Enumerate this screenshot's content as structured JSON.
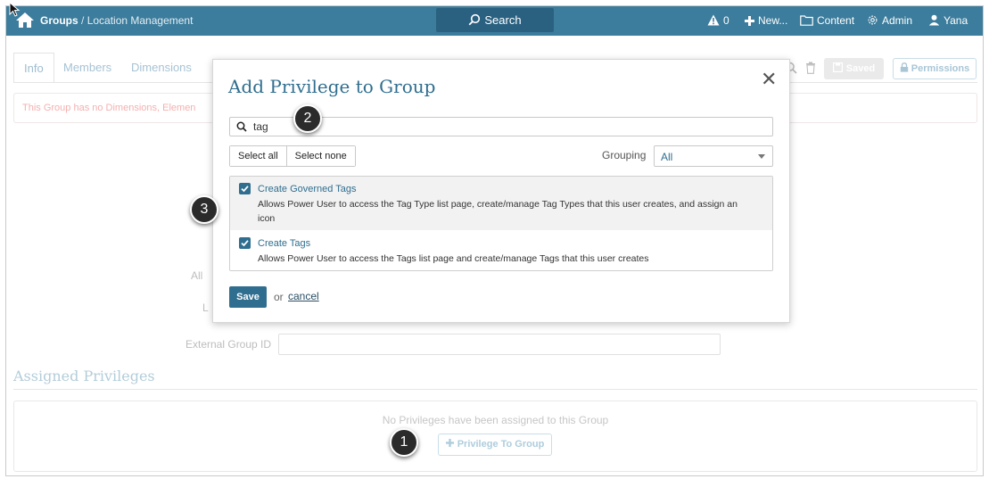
{
  "topnav": {
    "breadcrumb_root": "Groups",
    "breadcrumb_sep": " / ",
    "breadcrumb_current": "Location Management",
    "search_label": "Search",
    "alerts_count": "0",
    "new_label": "New...",
    "content_label": "Content",
    "admin_label": "Admin",
    "user_label": "Yana",
    "bar_color": "#3c7c9c"
  },
  "page": {
    "tabs": [
      "Info",
      "Members",
      "Dimensions"
    ],
    "warning_text": "This Group has no Dimensions, Elemen",
    "saved_label": "Saved",
    "permissions_label": "Permissions",
    "field_label_all": "All",
    "field_label_l": "L",
    "external_group_id_label": "External Group ID",
    "assigned_privileges_title": "Assigned Privileges",
    "no_privileges_text": "No Privileges have been assigned to this Group",
    "add_privilege_label": "Privilege To Group"
  },
  "modal": {
    "title": "Add Privilege to Group",
    "close_glyph": "✕",
    "search_value": "tag",
    "select_all_label": "Select all",
    "select_none_label": "Select none",
    "grouping_label": "Grouping",
    "grouping_value": "All",
    "privileges": [
      {
        "name": "Create Governed Tags",
        "description": "Allows Power User to access the Tag Type list page, create/manage Tag Types that this user creates, and assign an icon",
        "checked": true
      },
      {
        "name": "Create Tags",
        "description": "Allows Power User to access the Tags list page and create/manage Tags that this user creates",
        "checked": true
      }
    ],
    "save_label": "Save",
    "or_text": "or",
    "cancel_label": "cancel",
    "accent_color": "#2f6e8f"
  },
  "callouts": [
    "1",
    "2",
    "3"
  ]
}
